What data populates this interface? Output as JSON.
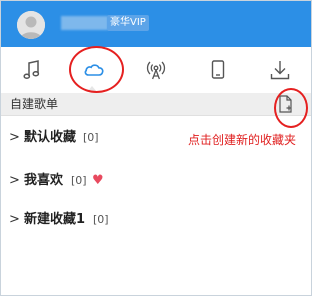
{
  "header": {
    "vip_badge": "豪华VIP"
  },
  "tabs": [
    {
      "icon": "music-note-icon"
    },
    {
      "icon": "cloud-icon",
      "active": true
    },
    {
      "icon": "radio-broadcast-icon"
    },
    {
      "icon": "mobile-device-icon"
    },
    {
      "icon": "download-icon"
    }
  ],
  "subbar": {
    "label": "自建歌单",
    "new_playlist_icon": "new-file-plus-icon"
  },
  "playlists": [
    {
      "name": "默认收藏",
      "count": "[0]"
    },
    {
      "name": "我喜欢",
      "count": "[0]",
      "icon": "heart-icon"
    },
    {
      "name": "新建收藏1",
      "count": "[0]"
    }
  ],
  "annotation": {
    "text": "点击创建新的收藏夹",
    "color": "#e02020"
  },
  "colors": {
    "header_bg": "#2c8fe6",
    "accent": "#2c8fe6",
    "highlight_ring": "#e52020",
    "heart": "#e84a5f"
  }
}
